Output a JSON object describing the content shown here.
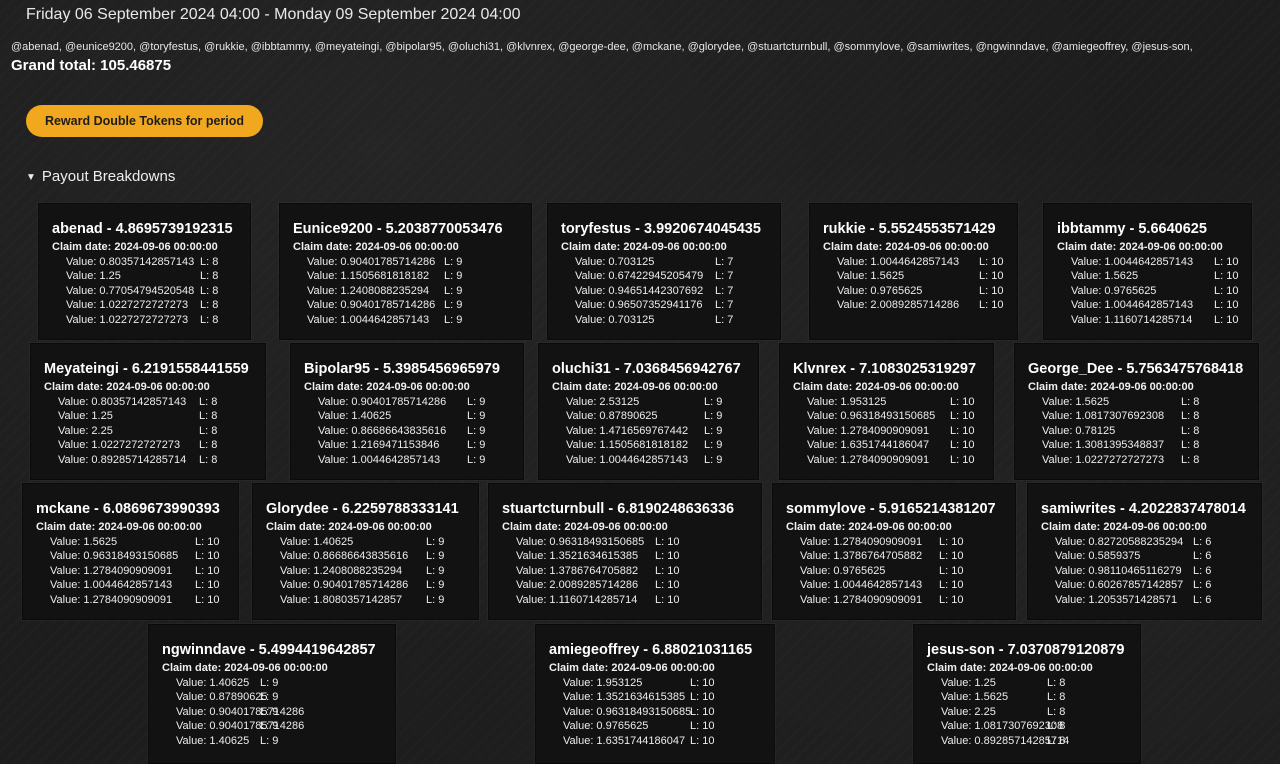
{
  "header": {
    "period": "Friday 06 September 2024 04:00 - Monday 09 September 2024 04:00",
    "users": "@abenad, @eunice9200, @toryfestus, @rukkie, @ibbtammy, @meyateingi, @bipolar95, @oluchi31, @klvnrex, @george-dee, @mckane, @glorydee, @stuartcturnbull, @sommylove, @samiwrites, @ngwinndave, @amiegeoffrey, @jesus-son,",
    "grand_total": "Grand total: 105.46875"
  },
  "reward_button": "Reward Double Tokens for period",
  "payout_summary": "Payout Breakdowns",
  "claim_label": "Claim date:",
  "claim_date": "2024-09-06 00:00:00",
  "cards": [
    {
      "title": "abenad - 4.8695739192315",
      "rows": [
        [
          "Value: 0.80357142857143",
          "L: 8"
        ],
        [
          "Value: 1.25",
          "L: 8"
        ],
        [
          "Value: 0.77054794520548",
          "L: 8"
        ],
        [
          "Value: 1.0227272727273",
          "L: 8"
        ],
        [
          "Value: 1.0227272727273",
          "L: 8"
        ]
      ]
    },
    {
      "title": "Eunice9200 - 5.2038770053476",
      "rows": [
        [
          "Value: 0.90401785714286",
          "L: 9"
        ],
        [
          "Value: 1.1505681818182",
          "L: 9"
        ],
        [
          "Value: 1.2408088235294",
          "L: 9"
        ],
        [
          "Value: 0.90401785714286",
          "L: 9"
        ],
        [
          "Value: 1.0044642857143",
          "L: 9"
        ]
      ]
    },
    {
      "title": "toryfestus - 3.9920674045435",
      "rows": [
        [
          "Value: 0.703125",
          "L: 7"
        ],
        [
          "Value: 0.67422945205479",
          "L: 7"
        ],
        [
          "Value: 0.94651442307692",
          "L: 7"
        ],
        [
          "Value: 0.96507352941176",
          "L: 7"
        ],
        [
          "Value: 0.703125",
          "L: 7"
        ]
      ]
    },
    {
      "title": "rukkie - 5.5524553571429",
      "rows": [
        [
          "Value: 1.0044642857143",
          "L: 10"
        ],
        [
          "Value: 1.5625",
          "L: 10"
        ],
        [
          "Value: 0.9765625",
          "L: 10"
        ],
        [
          "Value: 2.0089285714286",
          "L: 10"
        ]
      ]
    },
    {
      "title": "ibbtammy - 5.6640625",
      "rows": [
        [
          "Value: 1.0044642857143",
          "L: 10"
        ],
        [
          "Value: 1.5625",
          "L: 10"
        ],
        [
          "Value: 0.9765625",
          "L: 10"
        ],
        [
          "Value: 1.0044642857143",
          "L: 10"
        ],
        [
          "Value: 1.1160714285714",
          "L: 10"
        ]
      ]
    },
    {
      "title": "Meyateingi - 6.2191558441559",
      "rows": [
        [
          "Value: 0.80357142857143",
          "L: 8"
        ],
        [
          "Value: 1.25",
          "L: 8"
        ],
        [
          "Value: 2.25",
          "L: 8"
        ],
        [
          "Value: 1.0227272727273",
          "L: 8"
        ],
        [
          "Value: 0.89285714285714",
          "L: 8"
        ]
      ]
    },
    {
      "title": "Bipolar95 - 5.3985456965979",
      "rows": [
        [
          "Value: 0.90401785714286",
          "L: 9"
        ],
        [
          "Value: 1.40625",
          "L: 9"
        ],
        [
          "Value: 0.86686643835616",
          "L: 9"
        ],
        [
          "Value: 1.2169471153846",
          "L: 9"
        ],
        [
          "Value: 1.0044642857143",
          "L: 9"
        ]
      ]
    },
    {
      "title": "oluchi31 - 7.0368456942767",
      "rows": [
        [
          "Value: 2.53125",
          "L: 9"
        ],
        [
          "Value: 0.87890625",
          "L: 9"
        ],
        [
          "Value: 1.4716569767442",
          "L: 9"
        ],
        [
          "Value: 1.1505681818182",
          "L: 9"
        ],
        [
          "Value: 1.0044642857143",
          "L: 9"
        ]
      ]
    },
    {
      "title": "Klvnrex - 7.1083025319297",
      "rows": [
        [
          "Value: 1.953125",
          "L: 10"
        ],
        [
          "Value: 0.96318493150685",
          "L: 10"
        ],
        [
          "Value: 1.2784090909091",
          "L: 10"
        ],
        [
          "Value: 1.6351744186047",
          "L: 10"
        ],
        [
          "Value: 1.2784090909091",
          "L: 10"
        ]
      ]
    },
    {
      "title": "George_Dee - 5.7563475768418",
      "rows": [
        [
          "Value: 1.5625",
          "L: 8"
        ],
        [
          "Value: 1.0817307692308",
          "L: 8"
        ],
        [
          "Value: 0.78125",
          "L: 8"
        ],
        [
          "Value: 1.3081395348837",
          "L: 8"
        ],
        [
          "Value: 1.0227272727273",
          "L: 8"
        ]
      ]
    },
    {
      "title": "mckane - 6.0869673990393",
      "rows": [
        [
          "Value: 1.5625",
          "L: 10"
        ],
        [
          "Value: 0.96318493150685",
          "L: 10"
        ],
        [
          "Value: 1.2784090909091",
          "L: 10"
        ],
        [
          "Value: 1.0044642857143",
          "L: 10"
        ],
        [
          "Value: 1.2784090909091",
          "L: 10"
        ]
      ]
    },
    {
      "title": "Glorydee - 6.2259788333141",
      "rows": [
        [
          "Value: 1.40625",
          "L: 9"
        ],
        [
          "Value: 0.86686643835616",
          "L: 9"
        ],
        [
          "Value: 1.2408088235294",
          "L: 9"
        ],
        [
          "Value: 0.90401785714286",
          "L: 9"
        ],
        [
          "Value: 1.8080357142857",
          "L: 9"
        ]
      ]
    },
    {
      "title": "stuartcturnbull - 6.8190248636336",
      "rows": [
        [
          "Value: 0.96318493150685",
          "L: 10"
        ],
        [
          "Value: 1.3521634615385",
          "L: 10"
        ],
        [
          "Value: 1.3786764705882",
          "L: 10"
        ],
        [
          "Value: 2.0089285714286",
          "L: 10"
        ],
        [
          "Value: 1.1160714285714",
          "L: 10"
        ]
      ]
    },
    {
      "title": "sommylove - 5.9165214381207",
      "rows": [
        [
          "Value: 1.2784090909091",
          "L: 10"
        ],
        [
          "Value: 1.3786764705882",
          "L: 10"
        ],
        [
          "Value: 0.9765625",
          "L: 10"
        ],
        [
          "Value: 1.0044642857143",
          "L: 10"
        ],
        [
          "Value: 1.2784090909091",
          "L: 10"
        ]
      ]
    },
    {
      "title": "samiwrites - 4.2022837478014",
      "rows": [
        [
          "Value: 0.82720588235294",
          "L: 6"
        ],
        [
          "Value: 0.5859375",
          "L: 6"
        ],
        [
          "Value: 0.98110465116279",
          "L: 6"
        ],
        [
          "Value: 0.60267857142857",
          "L: 6"
        ],
        [
          "Value: 1.2053571428571",
          "L: 6"
        ]
      ]
    },
    {
      "title": "ngwinndave - 5.4994419642857",
      "rows": [
        [
          "Value: 1.40625",
          "L: 9"
        ],
        [
          "Value: 0.87890625",
          "L: 9"
        ],
        [
          "Value: 0.90401785714286",
          "L: 9"
        ],
        [
          "Value: 0.90401785714286",
          "L: 9"
        ],
        [
          "Value: 1.40625",
          "L: 9"
        ]
      ]
    },
    {
      "title": "amiegeoffrey - 6.88021031165",
      "rows": [
        [
          "Value: 1.953125",
          "L: 10"
        ],
        [
          "Value: 1.3521634615385",
          "L: 10"
        ],
        [
          "Value: 0.96318493150685",
          "L: 10"
        ],
        [
          "Value: 0.9765625",
          "L: 10"
        ],
        [
          "Value: 1.6351744186047",
          "L: 10"
        ]
      ]
    },
    {
      "title": "jesus-son - 7.0370879120879",
      "rows": [
        [
          "Value: 1.25",
          "L: 8"
        ],
        [
          "Value: 1.5625",
          "L: 8"
        ],
        [
          "Value: 2.25",
          "L: 8"
        ],
        [
          "Value: 1.0817307692308",
          "L: 8"
        ],
        [
          "Value: 0.89285714285714",
          "L: 8"
        ]
      ]
    }
  ]
}
